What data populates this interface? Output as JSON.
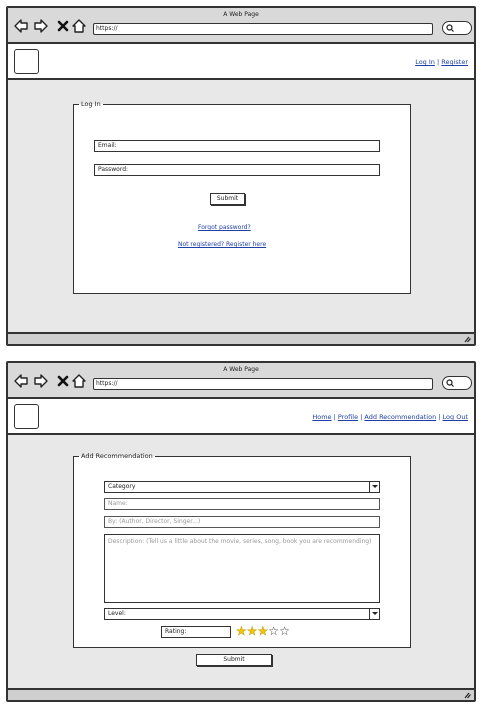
{
  "login_screen": {
    "window_title": "A Web Page",
    "url": "https://",
    "header_links": [
      "Log In",
      "Register"
    ],
    "form": {
      "legend": "Log In",
      "email_value": "Email:",
      "password_value": "Password:",
      "submit_label": "Submit",
      "forgot_link": "Forgot password?",
      "register_link": "Not registered? Register here"
    }
  },
  "recommendation_screen": {
    "window_title": "A Web Page",
    "url": "https://",
    "header_links": [
      "Home",
      "Profile",
      "Add Recommendation",
      "Log Out"
    ],
    "form": {
      "legend": "Add Recommendation",
      "category_value": "Category",
      "name_placeholder": "Name:",
      "by_placeholder": "By: (Author, Director, Singer...)",
      "description_placeholder": "Description: (Tell us a little about the movie, series, song, book you are recommending)",
      "level_value": "Level:",
      "rating_label": "Rating:",
      "rating_value": 3,
      "rating_max": 5,
      "submit_label": "Submit"
    }
  },
  "separator": " | ",
  "colors": {
    "link": "#1f3fa6",
    "star_filled": "#f2c500",
    "content_bg": "#e8e8e8",
    "chrome_bg": "#d9d9d9"
  }
}
